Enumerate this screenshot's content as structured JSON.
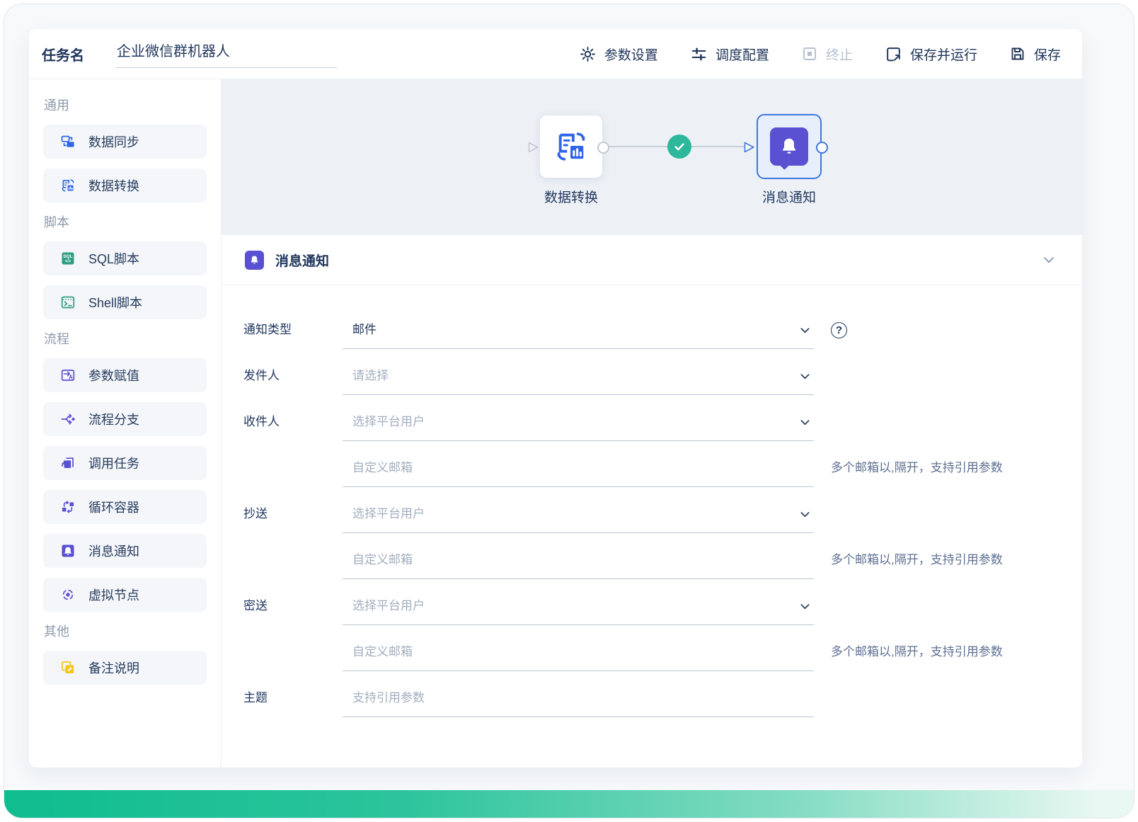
{
  "header": {
    "task_name_label": "任务名",
    "task_name_value": "企业微信群机器人",
    "toolbar": [
      {
        "label": "参数设置",
        "icon": "gear-icon",
        "disabled": false
      },
      {
        "label": "调度配置",
        "icon": "sliders-icon",
        "disabled": false
      },
      {
        "label": "终止",
        "icon": "stop-icon",
        "disabled": true
      },
      {
        "label": "保存并运行",
        "icon": "save-run-icon",
        "disabled": false
      },
      {
        "label": "保存",
        "icon": "save-icon",
        "disabled": false
      }
    ]
  },
  "sidebar": {
    "sections": [
      {
        "title": "通用",
        "items": [
          {
            "label": "数据同步",
            "icon": "data-sync-icon",
            "color": "#2f63e8"
          },
          {
            "label": "数据转换",
            "icon": "data-transform-icon",
            "color": "#2f63e8"
          }
        ]
      },
      {
        "title": "脚本",
        "items": [
          {
            "label": "SQL脚本",
            "icon": "sql-script-icon",
            "color": "#2f9e82"
          },
          {
            "label": "Shell脚本",
            "icon": "shell-script-icon",
            "color": "#2f9e82"
          }
        ]
      },
      {
        "title": "流程",
        "items": [
          {
            "label": "参数赋值",
            "icon": "param-assign-icon",
            "color": "#5a50d2"
          },
          {
            "label": "流程分支",
            "icon": "branch-icon",
            "color": "#5a50d2"
          },
          {
            "label": "调用任务",
            "icon": "call-task-icon",
            "color": "#5a50d2"
          },
          {
            "label": "循环容器",
            "icon": "loop-container-icon",
            "color": "#5a50d2"
          },
          {
            "label": "消息通知",
            "icon": "notification-icon",
            "color": "#5a50d2"
          },
          {
            "label": "虚拟节点",
            "icon": "virtual-node-icon",
            "color": "#5a50d2"
          }
        ]
      },
      {
        "title": "其他",
        "items": [
          {
            "label": "备注说明",
            "icon": "note-icon",
            "color": "#f5c518"
          }
        ]
      }
    ]
  },
  "canvas": {
    "nodes": [
      {
        "label": "数据转换",
        "selected": false
      },
      {
        "label": "消息通知",
        "selected": true
      }
    ],
    "edge_status": "success"
  },
  "panel": {
    "title": "消息通知",
    "fields": [
      {
        "label": "通知类型",
        "value": "邮件",
        "type": "select",
        "help": true
      },
      {
        "label": "发件人",
        "placeholder": "请选择",
        "type": "select"
      },
      {
        "label": "收件人",
        "placeholder": "选择平台用户",
        "type": "select"
      },
      {
        "label": "",
        "placeholder": "自定义邮箱",
        "type": "text",
        "hint": "多个邮箱以,隔开，支持引用参数"
      },
      {
        "label": "抄送",
        "placeholder": "选择平台用户",
        "type": "select"
      },
      {
        "label": "",
        "placeholder": "自定义邮箱",
        "type": "text",
        "hint": "多个邮箱以,隔开，支持引用参数"
      },
      {
        "label": "密送",
        "placeholder": "选择平台用户",
        "type": "select"
      },
      {
        "label": "",
        "placeholder": "自定义邮箱",
        "type": "text",
        "hint": "多个邮箱以,隔开，支持引用参数"
      },
      {
        "label": "主题",
        "placeholder": "支持引用参数",
        "type": "text"
      }
    ]
  },
  "icons": {
    "help_glyph": "?"
  },
  "colors": {
    "accent_blue": "#2f63e8",
    "flow_purple": "#5a50d2",
    "script_green": "#2f9e82",
    "note_yellow": "#f5c518",
    "success_green": "#2db79b",
    "selected_node_border": "#3e77e0",
    "canvas_bg": "#edf1f6",
    "footer_gradient_left": "#0fbd8e",
    "footer_gradient_right": "#eaf8f2"
  }
}
